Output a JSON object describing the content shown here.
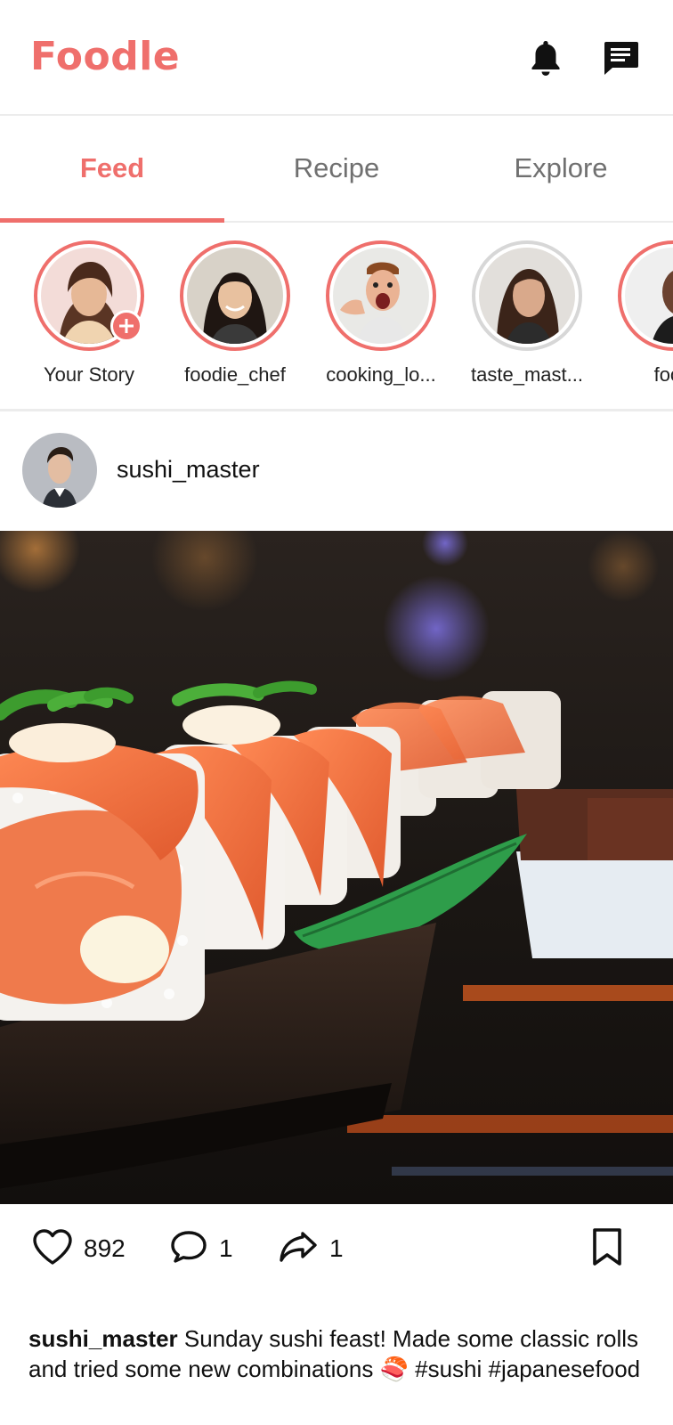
{
  "header": {
    "title": "Foodle",
    "icons": [
      "bell-icon",
      "chat-icon"
    ]
  },
  "tabs": [
    {
      "label": "Feed",
      "active": true
    },
    {
      "label": "Recipe",
      "active": false
    },
    {
      "label": "Explore",
      "active": false
    }
  ],
  "stories": [
    {
      "name": "Your Story",
      "own": true
    },
    {
      "name": "foodie_chef"
    },
    {
      "name": "cooking_lo..."
    },
    {
      "name": "taste_mast..."
    },
    {
      "name": "food"
    }
  ],
  "post": {
    "username": "sushi_master",
    "likes": "892",
    "comments": "1",
    "shares": "1",
    "caption_user": "sushi_master",
    "caption_text": "Sunday sushi feast! Made some classic rolls and tried some new combinations 🍣 #sushi #japanesefood"
  },
  "colors": {
    "accent": "#ef6f6c",
    "tab_inactive": "#707070",
    "divider": "#ececec"
  }
}
